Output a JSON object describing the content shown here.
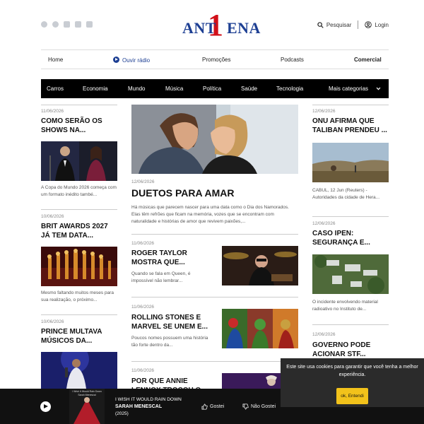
{
  "header": {
    "logo_text_left": "ANT",
    "logo_number": "1",
    "logo_text_right": "ENA",
    "search_label": "Pesquisar",
    "login_label": "Login",
    "social_icons": [
      "facebook-icon",
      "x-icon",
      "instagram-icon",
      "linkedin-icon",
      "youtube-icon"
    ]
  },
  "nav": {
    "home": "Home",
    "listen": "Ouvir rádio",
    "promos": "Promoções",
    "podcasts": "Podcasts",
    "commercial": "Comercial"
  },
  "categories": [
    "Carros",
    "Economia",
    "Mundo",
    "Música",
    "Política",
    "Saúde",
    "Tecnologia"
  ],
  "more_categories": "Mais categorias",
  "left": [
    {
      "date": "11/06/2026",
      "title": "COMO SERÃO OS SHOWS NA...",
      "excerpt": "A Copa do Mundo 2026 começa com um formato inédito també..."
    },
    {
      "date": "10/06/2026",
      "title": "BRIT AWARDS 2027 JÁ TEM DATA...",
      "excerpt": "Mesmo faltando muitos meses para sua realização, o próximo..."
    },
    {
      "date": "10/06/2026",
      "title": "PRINCE MULTAVA MÚSICOS DA..."
    }
  ],
  "featured": {
    "date": "12/06/2026",
    "title": "DUETOS PARA AMAR",
    "excerpt": "Há músicas que parecem nascer para uma data como o Dia dos Namorados. Elas têm refrões que ficam na memória, vozes que se encontram com naturalidade e histórias de amor que revivem paixões,..."
  },
  "middle": [
    {
      "date": "11/06/2026",
      "title": "ROGER TAYLOR MOSTRA QUE...",
      "excerpt": "Quando se fala em Queen, é impossível não lembrar..."
    },
    {
      "date": "11/06/2026",
      "title": "ROLLING STONES E MARVEL SE UNEM E...",
      "excerpt": "Poucos nomes possuem uma história tão forte dentro da..."
    },
    {
      "date": "11/06/2026",
      "title": "POR QUE ANNIE LENNOX TROCOU O..."
    }
  ],
  "right": [
    {
      "date": "12/06/2026",
      "title": "ONU AFIRMA QUE TALIBAN PRENDEU ...",
      "excerpt": "CABUL, 12 Jun (Reuters) - Autoridades da cidade de Hera..."
    },
    {
      "date": "12/06/2026",
      "title": "CASO IPEN: SEGURANÇA E...",
      "excerpt": "O incidente envolvendo material radioativo no Instituto de..."
    },
    {
      "date": "12/06/2026",
      "title": "GOVERNO PODE ACIONAR STF..."
    }
  ],
  "player": {
    "cover_title": "I Wish It Would Rain Down",
    "cover_artist": "Sarah Menescal",
    "song": "I WISH IT WOULD RAIN DOWN",
    "artist": "SARAH MENESCAL",
    "year": "(2025)",
    "like": "Gostei",
    "dislike": "Não Gostei"
  },
  "cookie": {
    "text": "Este site usa cookies para garantir que você tenha a melhor experiência.",
    "button": "ok, Entendi"
  },
  "colors": {
    "brand_blue": "#1d3f93",
    "brand_red": "#d1101a",
    "accept_yellow": "#f2c21b"
  }
}
